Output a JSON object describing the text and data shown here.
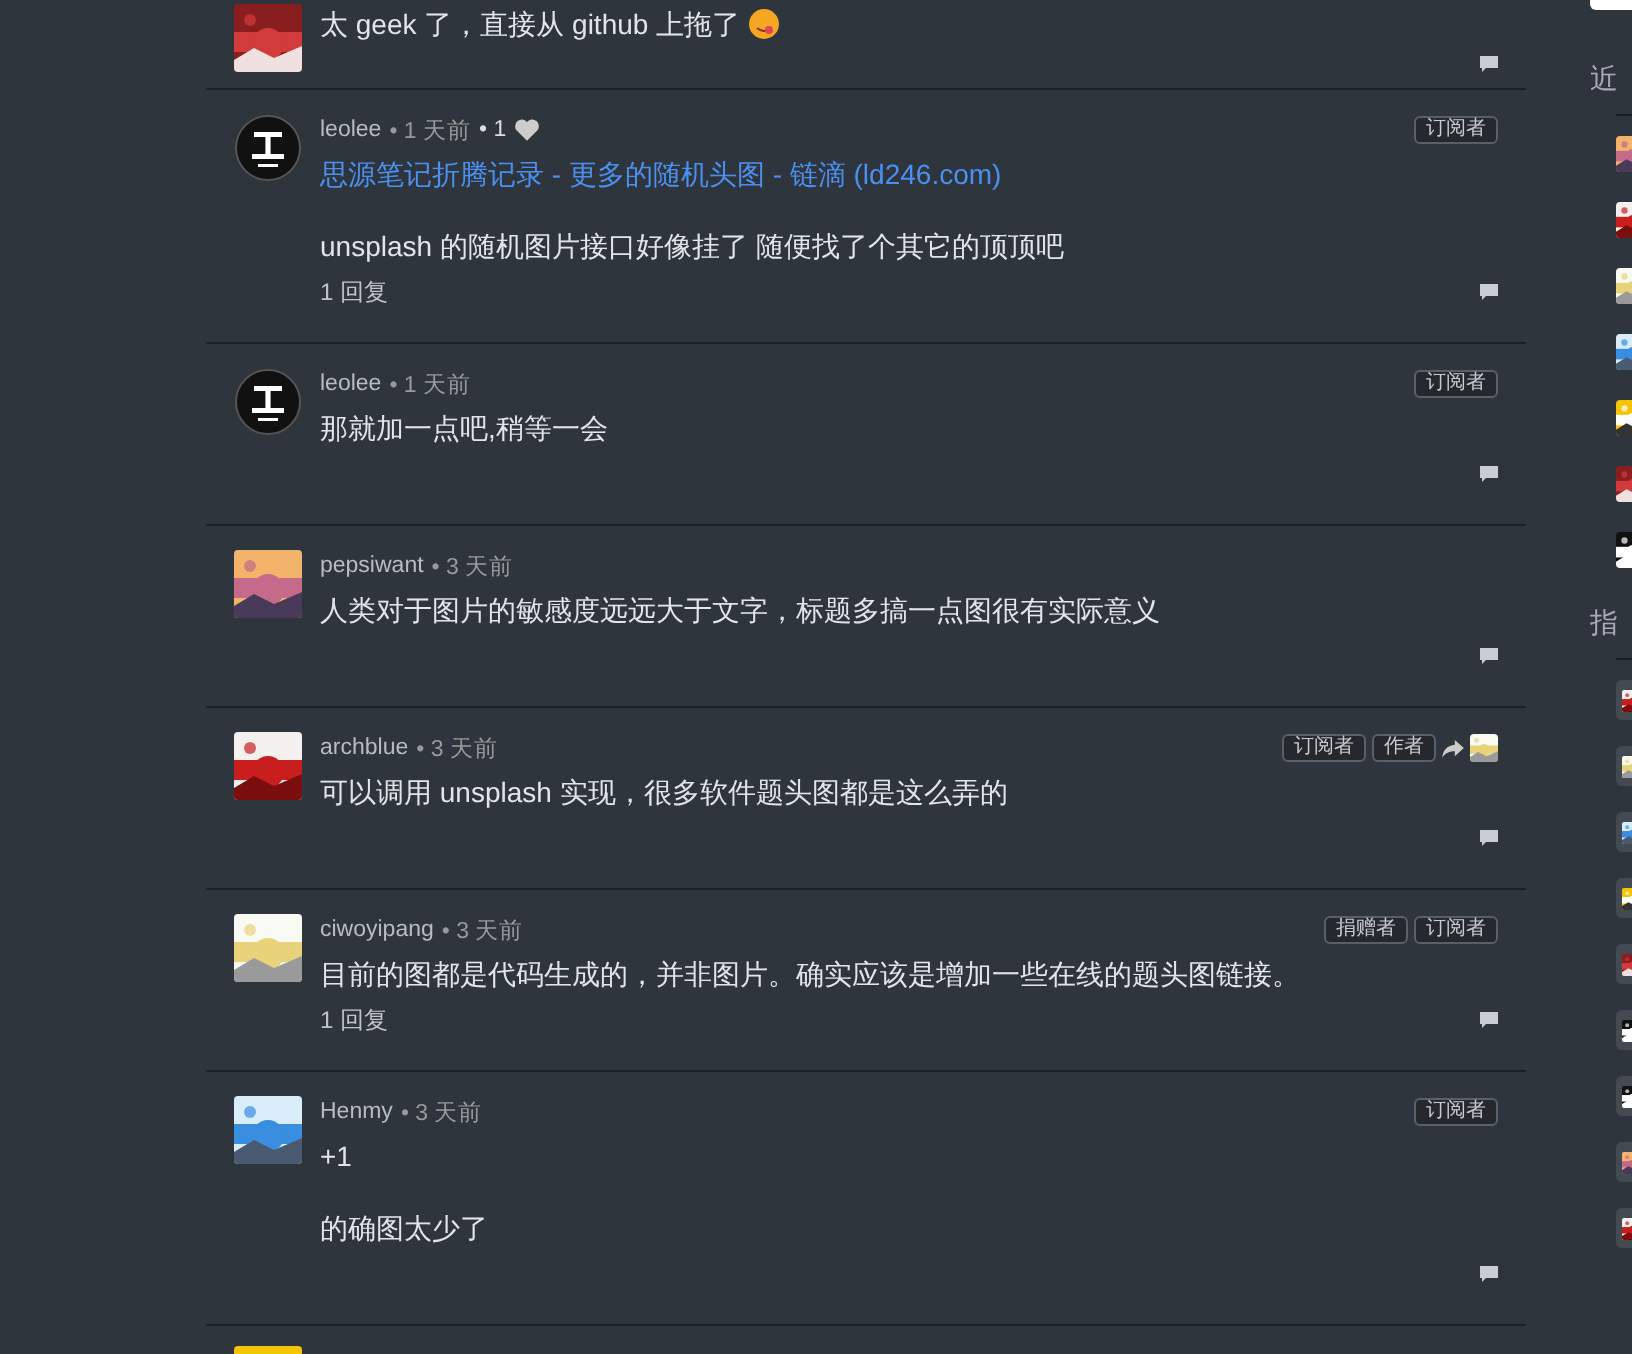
{
  "comments": [
    {
      "partial": true,
      "body": [
        {
          "kind": "text",
          "text": "太 geek 了，直接从 github 上拖了",
          "emoji": true
        }
      ]
    },
    {
      "user": "leolee",
      "time": "• 1 天前",
      "likes": "• 1",
      "badges": [
        "订阅者"
      ],
      "body": [
        {
          "kind": "link",
          "text": "思源笔记折腾记录 - 更多的随机头图 - 链滴 (ld246.com)"
        },
        {
          "kind": "text",
          "text": "unsplash 的随机图片接口好像挂了 随便找了个其它的顶顶吧"
        }
      ],
      "replies": "1 回复"
    },
    {
      "user": "leolee",
      "time": "• 1 天前",
      "badges": [
        "订阅者"
      ],
      "body": [
        {
          "kind": "text",
          "text": "那就加一点吧,稍等一会"
        }
      ]
    },
    {
      "user": "pepsiwant",
      "time": "• 3 天前",
      "body": [
        {
          "kind": "text",
          "text": "人类对于图片的敏感度远远大于文字，标题多搞一点图很有实际意义"
        }
      ]
    },
    {
      "user": "archblue",
      "time": "• 3 天前",
      "badges": [
        "订阅者",
        "作者"
      ],
      "share": true,
      "body": [
        {
          "kind": "text",
          "text": "可以调用 unsplash 实现，很多软件题头图都是这么弄的"
        }
      ]
    },
    {
      "user": "ciwoyipang",
      "time": "• 3 天前",
      "badges": [
        "捐赠者",
        "订阅者"
      ],
      "body": [
        {
          "kind": "text",
          "text": "目前的图都是代码生成的，并非图片。确实应该是增加一些在线的题头图链接。"
        }
      ],
      "replies": "1 回复"
    },
    {
      "user": "Henmy",
      "time": "• 3 天前",
      "badges": [
        "订阅者"
      ],
      "body": [
        {
          "kind": "text",
          "text": "+1"
        },
        {
          "kind": "text",
          "text": "的确图太少了"
        }
      ]
    }
  ],
  "sidebar": {
    "sections": [
      {
        "heading": "近"
      },
      {
        "heading": "指"
      }
    ]
  }
}
